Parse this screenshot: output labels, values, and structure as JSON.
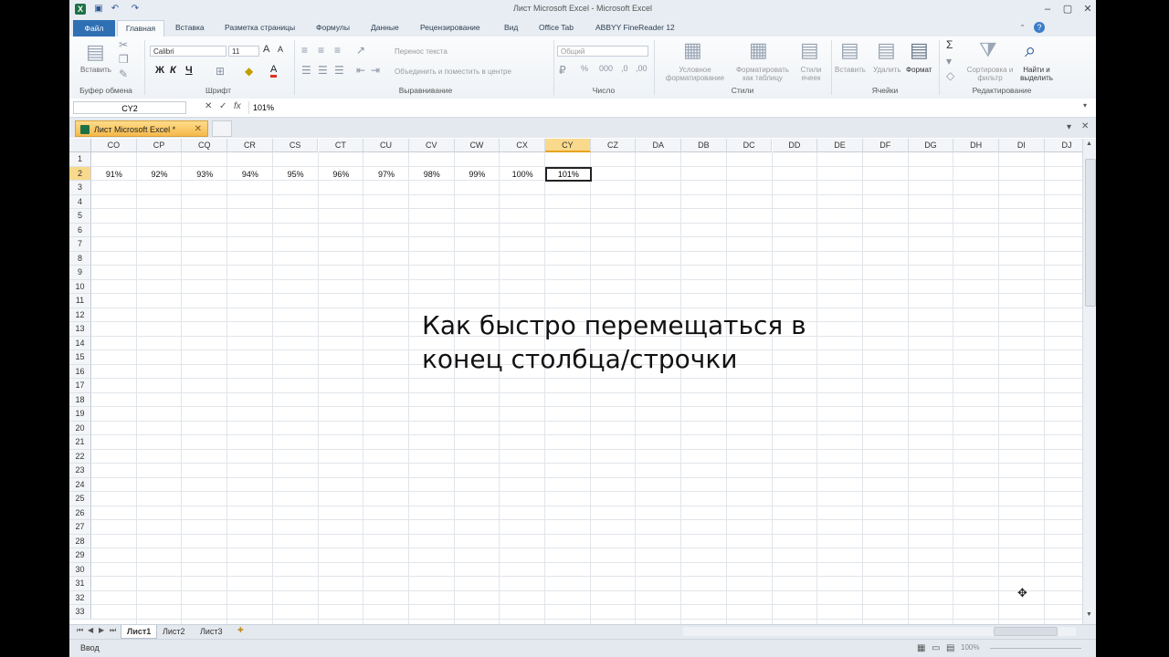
{
  "window": {
    "title": "Лист Microsoft Excel  -  Microsoft Excel"
  },
  "ribbon_tabs": [
    {
      "label": "Файл"
    },
    {
      "label": "Главная"
    },
    {
      "label": "Вставка"
    },
    {
      "label": "Разметка страницы"
    },
    {
      "label": "Формулы"
    },
    {
      "label": "Данные"
    },
    {
      "label": "Рецензирование"
    },
    {
      "label": "Вид"
    },
    {
      "label": "Office Tab"
    },
    {
      "label": "ABBYY FineReader 12"
    }
  ],
  "ribbon": {
    "paste_label": "Вставить",
    "clipboard_group": "Буфер обмена",
    "font_name": "Calibri",
    "font_size": "11",
    "font_group": "Шрифт",
    "wrap_text": "Перенос текста",
    "merge_center": "Объединить и поместить в центре",
    "alignment_group": "Выравнивание",
    "number_format": "Общий",
    "number_group": "Число",
    "conditional_formatting": "Условное форматирование",
    "format_as_table": "Форматировать как таблицу",
    "cell_styles": "Стили ячеек",
    "styles_group": "Стили",
    "insert_cells": "Вставить",
    "delete_cells": "Удалить",
    "format_cells": "Формат",
    "cells_group": "Ячейки",
    "sort_filter": "Сортировка и фильтр",
    "find_select": "Найти и выделить",
    "editing_group": "Редактирование",
    "bold": "Ж",
    "italic": "К",
    "underline": "Ч"
  },
  "formula_bar": {
    "name_box": "CY2",
    "fx": "fx",
    "value": "101%"
  },
  "document_tab": {
    "label": "Лист Microsoft Excel *"
  },
  "grid": {
    "columns": [
      "CO",
      "CP",
      "CQ",
      "CR",
      "CS",
      "CT",
      "CU",
      "CV",
      "CW",
      "CX",
      "CY",
      "CZ",
      "DA",
      "DB",
      "DC",
      "DD",
      "DE",
      "DF",
      "DG",
      "DH",
      "DI",
      "DJ"
    ],
    "selected_column": "CY",
    "rows": [
      "1",
      "2",
      "3",
      "4",
      "5",
      "6",
      "7",
      "8",
      "9",
      "10",
      "11",
      "12",
      "13",
      "14",
      "15",
      "16",
      "17",
      "18",
      "19",
      "20",
      "21",
      "22",
      "23",
      "24",
      "25",
      "26",
      "27",
      "28",
      "29",
      "30",
      "31",
      "32",
      "33"
    ],
    "selected_row": "2",
    "row2_values": [
      "91%",
      "92%",
      "93%",
      "94%",
      "95%",
      "96%",
      "97%",
      "98%",
      "99%",
      "100%",
      "101%"
    ]
  },
  "sheets": [
    {
      "label": "Лист1"
    },
    {
      "label": "Лист2"
    },
    {
      "label": "Лист3"
    }
  ],
  "status": {
    "mode": "Ввод",
    "zoom": "100%"
  },
  "caption": {
    "line1": "Как быстро перемещаться в",
    "line2": "конец столбца/строчки"
  }
}
